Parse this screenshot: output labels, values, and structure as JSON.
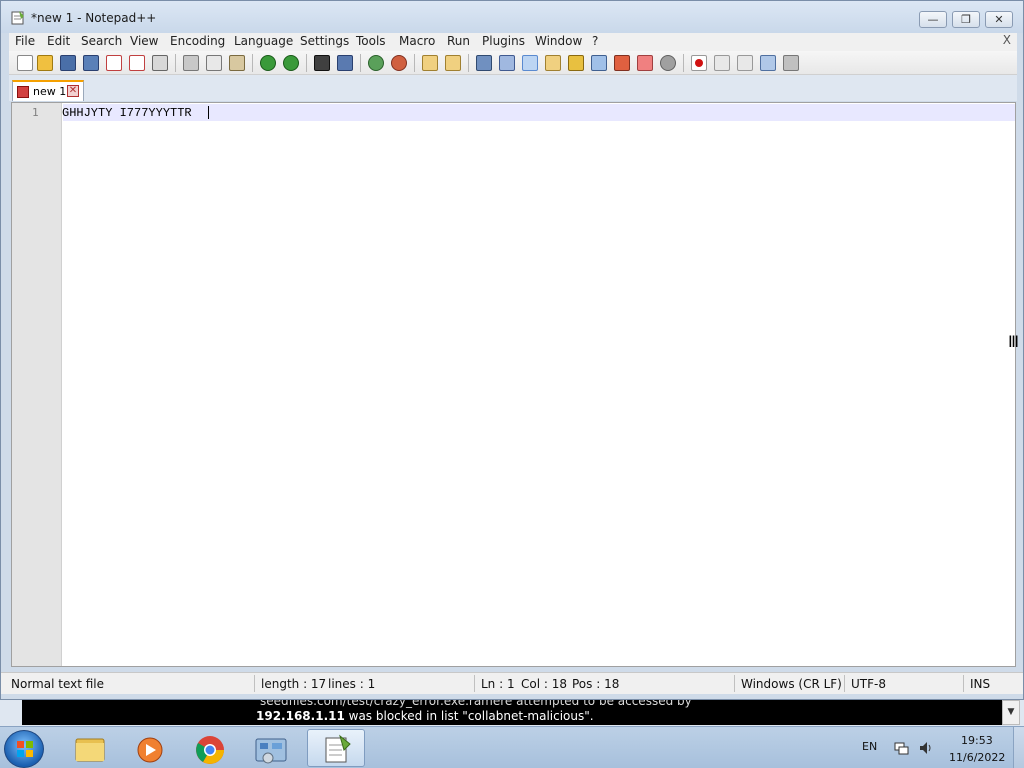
{
  "window": {
    "title": "*new 1 - Notepad++"
  },
  "menu": [
    "File",
    "Edit",
    "Search",
    "View",
    "Encoding",
    "Language",
    "Settings",
    "Tools",
    "Macro",
    "Run",
    "Plugins",
    "Window",
    "?"
  ],
  "menu_close": "X",
  "tabs": [
    {
      "label": "new 1"
    }
  ],
  "editor": {
    "line_number": "1",
    "content": "GHHJYTY I777YYYTTR"
  },
  "status": {
    "file_type": "Normal text file",
    "length": "length : 17",
    "lines": "lines : 1",
    "ln": "Ln : 1",
    "col": "Col : 18",
    "pos": "Pos : 18",
    "eol": "Windows (CR LF)",
    "encoding": "UTF-8",
    "mode": "INS"
  },
  "notification": {
    "line1": "seedfiles.com/test/crazy_error.exe.ramere  attempted to be accessed by",
    "ip": "192.168.1.11",
    "line2_rest": " was blocked in list \"collabnet-malicious\"."
  },
  "taskbar": {
    "apps": [
      "explorer-icon",
      "media-player-icon",
      "chrome-icon",
      "control-panel-icon",
      "notepadpp-icon"
    ],
    "language": "EN",
    "time": "19:53",
    "date": "11/6/2022"
  },
  "colors": {
    "accent_tab": "#f5a000",
    "current_line": "#e8e8ff"
  }
}
